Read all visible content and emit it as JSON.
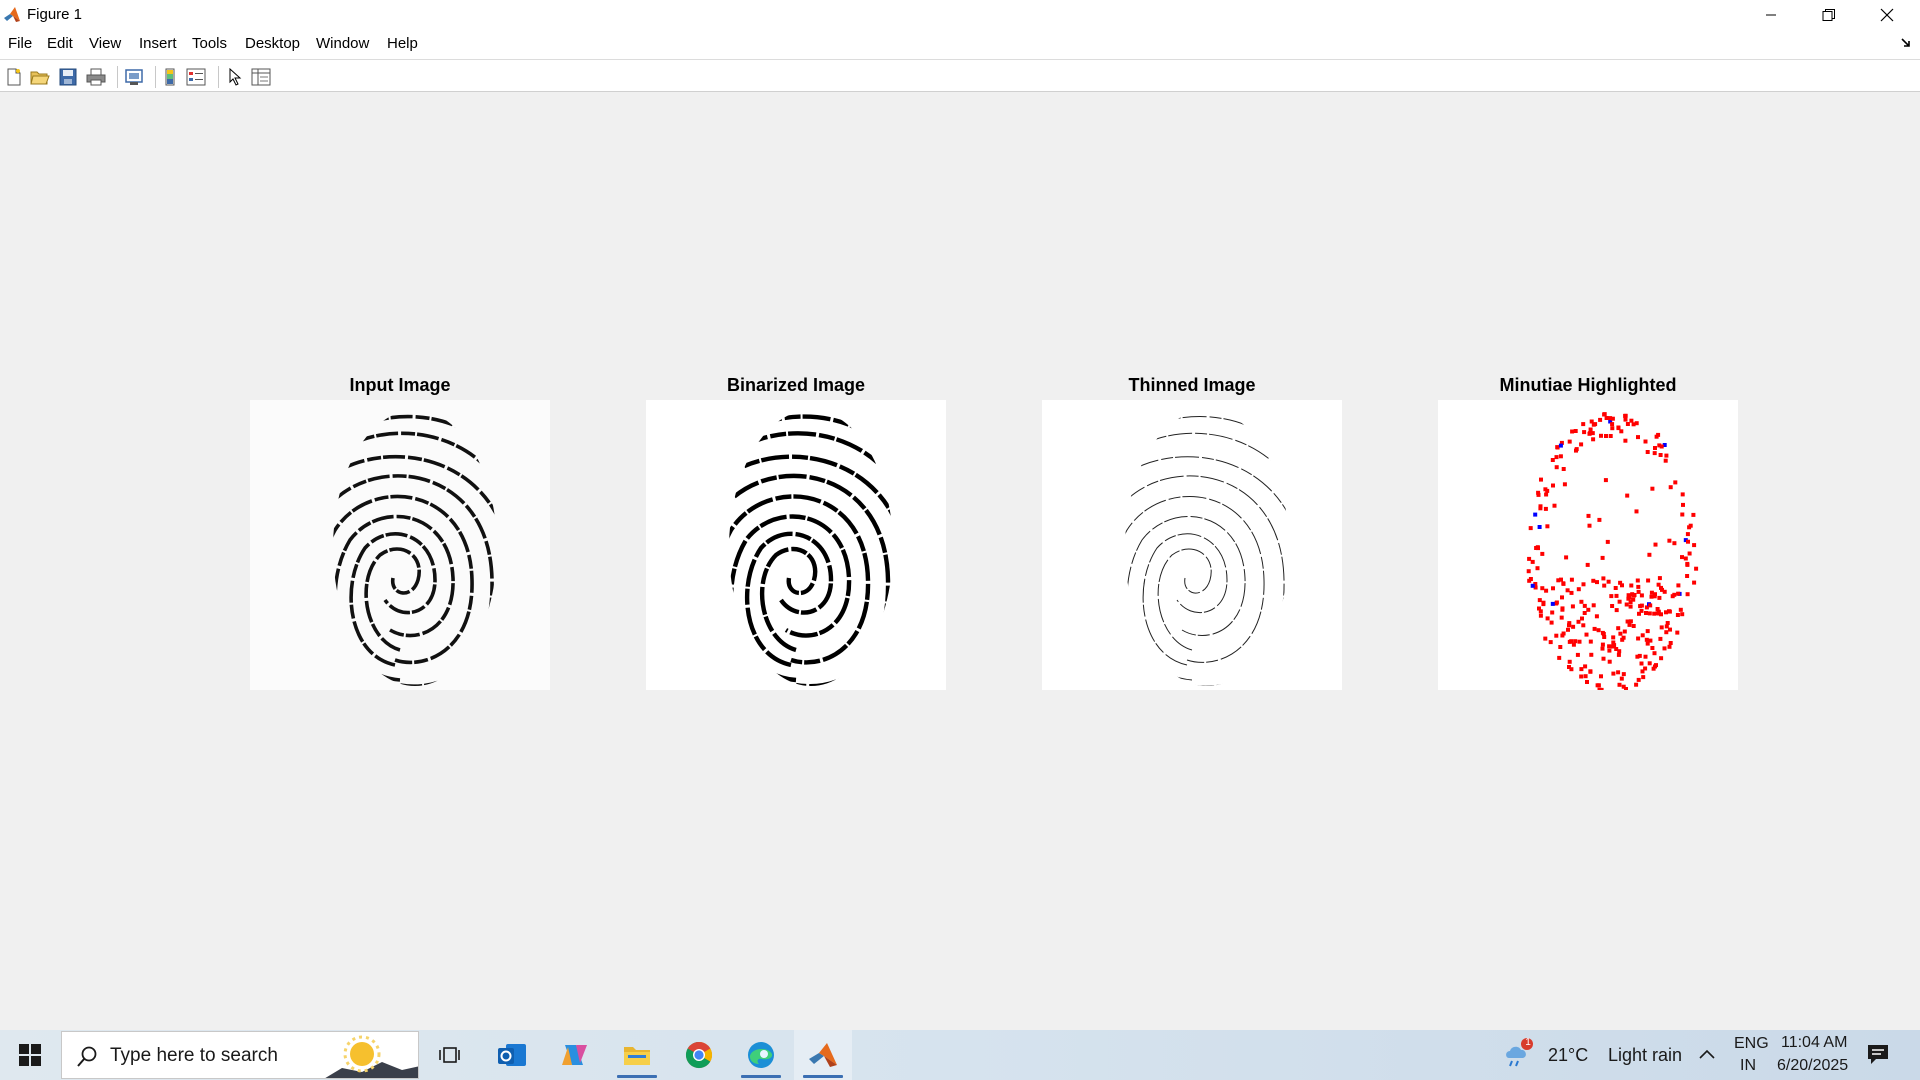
{
  "window": {
    "title": "Figure 1"
  },
  "menu": [
    "File",
    "Edit",
    "View",
    "Insert",
    "Tools",
    "Desktop",
    "Window",
    "Help"
  ],
  "toolbar": {
    "icons": [
      "new-figure-icon",
      "open-file-icon",
      "save-icon",
      "print-icon",
      "print-preview-icon",
      "colorbar-icon",
      "legend-icon",
      "select-pointer-icon",
      "property-inspector-icon"
    ]
  },
  "figure": {
    "axes": [
      {
        "title": "Input Image"
      },
      {
        "title": "Binarized Image"
      },
      {
        "title": "Thinned Image"
      },
      {
        "title": "Minutiae Highlighted"
      }
    ],
    "minutiae_colors": {
      "termination": "#ff0000",
      "bifurcation": "#0000ff"
    }
  },
  "taskbar": {
    "search_placeholder": "Type here to search",
    "apps": [
      "task-view-icon",
      "outlook-icon",
      "copilot-icon",
      "file-explorer-icon",
      "chrome-icon",
      "edge-icon",
      "matlab-icon"
    ],
    "weather": {
      "temp": "21°C",
      "condition": "Light rain",
      "badge": "1"
    },
    "language": {
      "line1": "ENG",
      "line2": "IN"
    },
    "clock": {
      "time": "11:04 AM",
      "date": "6/20/2025"
    }
  }
}
